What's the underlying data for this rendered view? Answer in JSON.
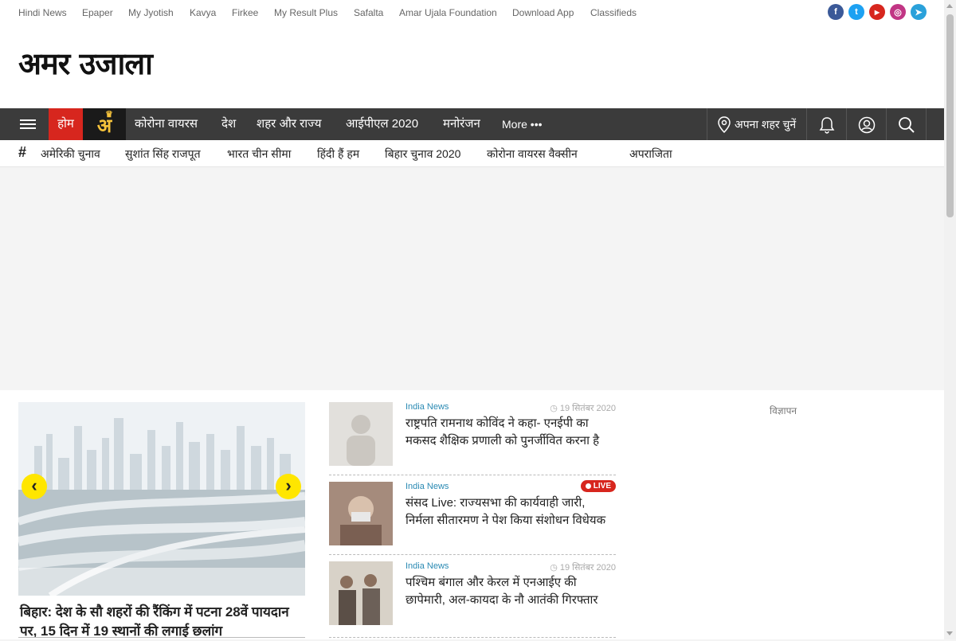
{
  "topbar": {
    "links": [
      "Hindi News",
      "Epaper",
      "My Jyotish",
      "Kavya",
      "Firkee",
      "My Result Plus",
      "Safalta",
      "Amar Ujala Foundation",
      "Download App",
      "Classifieds"
    ],
    "social": [
      {
        "icon": "facebook-icon",
        "glyph": "f",
        "color": "#3b5998"
      },
      {
        "icon": "twitter-icon",
        "glyph": "t",
        "color": "#1da1f2"
      },
      {
        "icon": "youtube-icon",
        "glyph": "▶",
        "color": "#d7261e"
      },
      {
        "icon": "instagram-icon",
        "glyph": "◎",
        "color": "#c13584"
      },
      {
        "icon": "telegram-icon",
        "glyph": "➤",
        "color": "#2aa1da"
      }
    ]
  },
  "logo": {
    "text": "अमर उजाला",
    "badge": "अ"
  },
  "nav": {
    "home": "होम",
    "items": [
      "कोरोना वायरस",
      "देश",
      "शहर और राज्य",
      "आईपीएल 2020",
      "मनोरंजन"
    ],
    "more": "More •••",
    "city": "अपना शहर चुनें",
    "colors": {
      "bar": "#3b3b3b",
      "home": "#d7261e"
    }
  },
  "tags": {
    "symbol": "#",
    "items": [
      "अमेरिकी चुनाव",
      "सुशांत सिंह राजपूत",
      "भारत चीन सीमा",
      "हिंदी हैं हम",
      "बिहार चुनाव 2020",
      "कोरोना वायरस वैक्सीन",
      "अपराजिता"
    ]
  },
  "hero": {
    "title": "बिहार: देश के सौ शहरों की रैंकिंग में पटना 28वें पायदान पर, 15 दिन में 19 स्थानों की लगाई छलांग",
    "prev": "‹",
    "next": "›"
  },
  "stories": [
    {
      "category": "India News",
      "date": "19 सितंबर 2020",
      "title": "राष्ट्रपति रामनाथ कोविंद ने कहा- एनईपी का मकसद शैक्षिक प्रणाली को पुनर्जीवित करना है",
      "live": ""
    },
    {
      "category": "India News",
      "date": "",
      "title": "संसद Live: राज्यसभा की कार्यवाही जारी, निर्मला सीतारमण ने पेश किया संशोधन विधेयक",
      "live": "LIVE"
    },
    {
      "category": "India News",
      "date": "19 सितंबर 2020",
      "title": "पश्चिम बंगाल और केरल में एनआईए की छापेमारी, अल-कायदा के नौ आतंकी गिरफ्तार",
      "live": ""
    }
  ],
  "ad": {
    "label": "विज्ञापन"
  }
}
